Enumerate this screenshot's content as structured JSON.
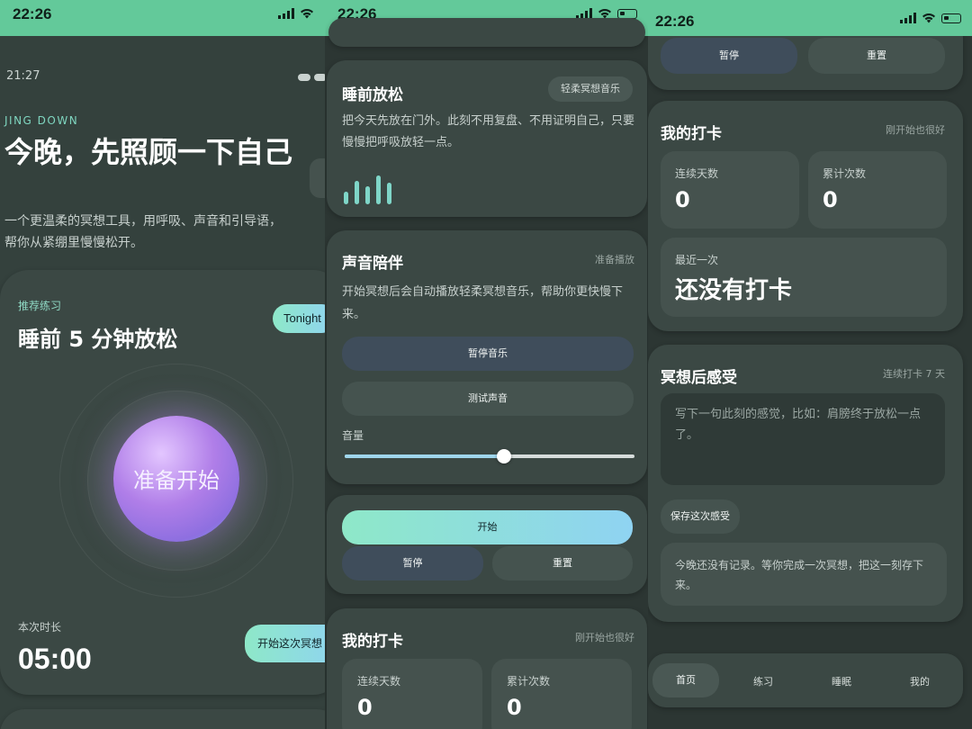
{
  "status": {
    "time1": "22:26",
    "time2": "22:26",
    "time3": "22:26"
  },
  "screen1": {
    "time_small": "21:27",
    "brand": "JING DOWN",
    "title": "今晚，先照顾一下自己",
    "subtitle": "一个更温柔的冥想工具，用呼吸、声音和引导语，帮你从紧绷里慢慢松开。",
    "card": {
      "label": "推荐练习",
      "title": "睡前 5 分钟放松",
      "badge": "Tonight",
      "orb_text": "准备开始",
      "duration_label": "本次时长",
      "duration": "05:00",
      "start_button": "开始这次冥想"
    }
  },
  "screen2": {
    "relax": {
      "title": "睡前放松",
      "tag": "轻柔冥想音乐",
      "desc": "把今天先放在门外。此刻不用复盘、不用证明自己，只要慢慢把呼吸放轻一点。"
    },
    "sound": {
      "title": "声音陪伴",
      "status": "准备播放",
      "desc": "开始冥想后会自动播放轻柔冥想音乐，帮助你更快慢下来。",
      "pause_music": "暂停音乐",
      "test_sound": "测试声音",
      "volume_label": "音量",
      "volume": 0.55
    },
    "controls": {
      "start": "开始",
      "pause": "暂停",
      "reset": "重置"
    },
    "checkin": {
      "title": "我的打卡",
      "hint": "刚开始也很好",
      "streak_label": "连续天数",
      "streak_value": "0",
      "total_label": "累计次数",
      "total_value": "0"
    }
  },
  "screen3": {
    "controls": {
      "pause": "暂停",
      "reset": "重置"
    },
    "checkin": {
      "title": "我的打卡",
      "hint": "刚开始也很好",
      "streak_label": "连续天数",
      "streak_value": "0",
      "total_label": "累计次数",
      "total_value": "0",
      "last_label": "最近一次",
      "last_value": "还没有打卡"
    },
    "feeling": {
      "title": "冥想后感受",
      "streak": "连续打卡 7 天",
      "placeholder": "写下一句此刻的感觉，比如：肩膀终于放松一点了。",
      "save": "保存这次感受",
      "empty": "今晚还没有记录。等你完成一次冥想，把这一刻存下来。"
    },
    "nav": {
      "home": "首页",
      "practice": "练习",
      "sleep": "睡眠",
      "mine": "我的"
    }
  },
  "colors": {
    "status_bar": "#63c99a",
    "accent": "#8ee8c8",
    "orb": "#b07ee8"
  }
}
